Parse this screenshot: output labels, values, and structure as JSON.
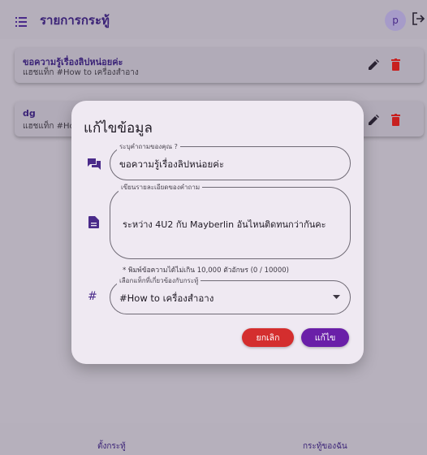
{
  "appbar": {
    "title": "รายการกระทู้",
    "avatar_letter": "p",
    "menu_icon": "menu-icon",
    "logout_icon": "logout-icon"
  },
  "cards": [
    {
      "title": "ขอความรู้เรื่องลิปหน่อยค่ะ",
      "subtitle": "แฮชแท็ก #How to เครื่องสำอาง"
    },
    {
      "title": "dg",
      "subtitle": "แฮชแท็ก #Ho"
    }
  ],
  "dialog": {
    "title": "แก้ไขข้อมูล",
    "question_field": {
      "label": "ระบุคำถามของคุณ ?",
      "value": "ขอความรู้เรื่องลิปหน่อยค่ะ"
    },
    "detail_field": {
      "label": "เขียนรายละเอียดของคำถาม",
      "value": "ระหว่าง 4U2 กับ Mayberlin อันไหนติดทนกว่ากันคะ"
    },
    "helper_text": "* พิมพ์ข้อความได้ไม่เกิน 10,000 ตัวอักษร (0 / 10000)",
    "tag_field": {
      "label": "เลือกแท็กที่เกี่ยวข้องกับกระทู้",
      "value": "#How to เครื่องสำอาง"
    },
    "cancel_label": "ยกเลิก",
    "save_label": "แก้ไข"
  },
  "bottom_nav": {
    "left_label": "ตั้งกระทู้",
    "right_label": "กระทู้ของฉัน"
  },
  "colors": {
    "accent": "#6a1fa8",
    "danger": "#d42e2e",
    "title_text": "#3b2377"
  }
}
